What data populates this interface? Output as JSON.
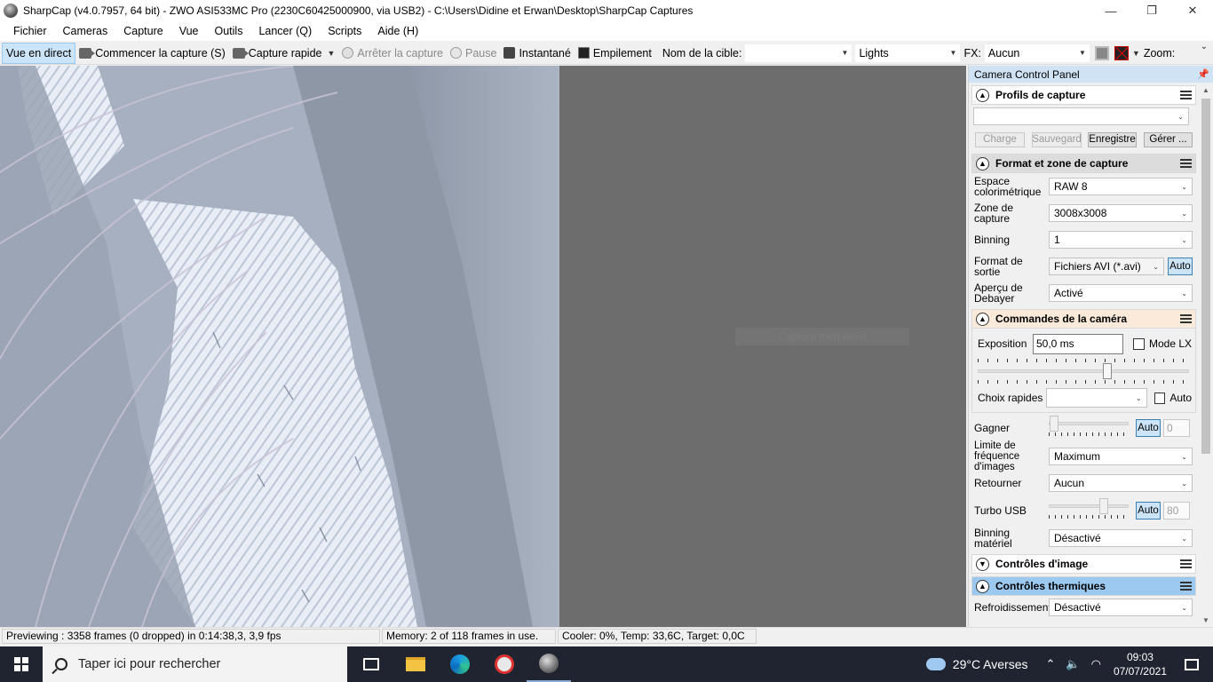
{
  "window": {
    "title": "SharpCap (v4.0.7957, 64 bit) - ZWO ASI533MC Pro (2230C60425000900, via USB2) - C:\\Users\\Didine et Erwan\\Desktop\\SharpCap Captures",
    "minimize": "—",
    "maximize": "❐",
    "close": "✕"
  },
  "menu": [
    "Fichier",
    "Cameras",
    "Capture",
    "Vue",
    "Outils",
    "Lancer (Q)",
    "Scripts",
    "Aide (H)"
  ],
  "toolbar": {
    "live_view": "Vue en direct",
    "start_capture": "Commencer la capture (S)",
    "quick_capture": "Capture rapide",
    "stop_capture": "Arrêter la capture",
    "pause": "Pause",
    "snapshot": "Instantané",
    "stacking": "Empilement",
    "target_label": "Nom de la cible:",
    "target_value": "",
    "frame_type": "Lights",
    "fx_label": "FX:",
    "fx_value": "Aucun",
    "zoom_label": "Zoom:"
  },
  "viewer": {
    "overlay_text": "Capture then reset"
  },
  "panel": {
    "title": "Camera Control Panel",
    "capture_profiles": {
      "title": "Profils de capture",
      "profile_value": "",
      "buttons": [
        "Charge",
        "Sauvegard",
        "Enregistre",
        "Gérer ..."
      ]
    },
    "format": {
      "title": "Format et zone de capture",
      "rows": [
        {
          "label": "Espace colorimétrique",
          "value": "RAW 8"
        },
        {
          "label": "Zone de capture",
          "value": "3008x3008"
        },
        {
          "label": "Binning",
          "value": "1"
        },
        {
          "label": "Format de sortie",
          "value": "Fichiers AVI (*.avi)",
          "auto": "Auto"
        },
        {
          "label": "Aperçu de Debayer",
          "value": "Activé"
        }
      ]
    },
    "camera": {
      "title": "Commandes de la caméra",
      "exposure_label": "Exposition",
      "exposure_value": "50,0 ms",
      "lx_mode": "Mode LX",
      "quick_choice_label": "Choix rapides",
      "quick_choice_value": "",
      "quick_auto": "Auto",
      "gain_label": "Gagner",
      "gain_auto": "Auto",
      "gain_value": "0",
      "framerate_label": "Limite de fréquence d'images",
      "framerate_value": "Maximum",
      "flip_label": "Retourner",
      "flip_value": "Aucun",
      "usb_label": "Turbo USB",
      "usb_auto": "Auto",
      "usb_value": "80",
      "hwbin_label": "Binning matériel",
      "hwbin_value": "Désactivé"
    },
    "image_controls": {
      "title": "Contrôles d'image"
    },
    "thermal": {
      "title": "Contrôles thermiques",
      "cooling_label": "Refroidissement",
      "cooling_value": "Désactivé"
    }
  },
  "status": {
    "preview": "Previewing : 3358 frames (0 dropped) in 0:14:38,3, 3,9 fps",
    "memory": "Memory: 2 of 118 frames in use.",
    "cooler": "Cooler: 0%, Temp: 33,6C, Target: 0,0C"
  },
  "taskbar": {
    "search_placeholder": "Taper ici pour rechercher",
    "weather": "29°C  Averses",
    "time": "09:03",
    "date": "07/07/2021"
  },
  "colors": {
    "viewer_bg": "#6d6d6d",
    "active_blue": "#cce4f7",
    "taskbar": "#1f2430",
    "thermal_header": "#9bc9f0",
    "camera_header": "#fbe9d9"
  }
}
